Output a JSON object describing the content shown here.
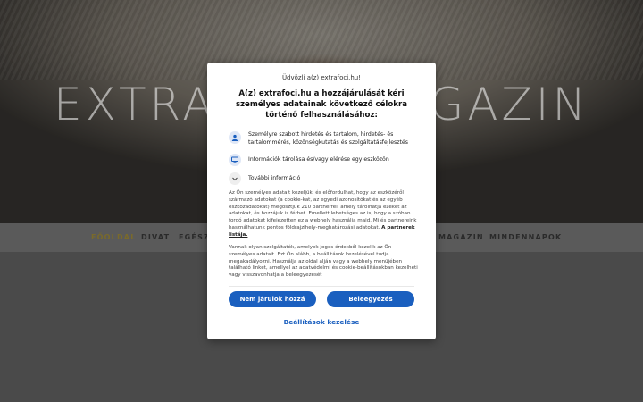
{
  "background": {
    "site_title": "EXTRAFOCI MAGAZIN",
    "nav": [
      "FŐOLDAL",
      "DIVAT",
      "EGÉSZSÉG",
      "MAGAZIN",
      "MINDENNAPOK"
    ]
  },
  "consent": {
    "welcome": "Üdvözli a(z) extrafoci.hu!",
    "heading": "A(z) extrafoci.hu a hozzájárulását kéri személyes adatainak következő célokra történő felhasználásához:",
    "purposes": [
      {
        "icon": "user-icon",
        "text": "Személyre szabott hirdetés és tartalom, hirdetés- és tartalommérés, közönségkutatás és szolgáltatásfejlesztés"
      },
      {
        "icon": "device-icon",
        "text": "Információk tárolása és/vagy elérése egy eszközön"
      }
    ],
    "more_info": "További információ",
    "paragraph1": "Az Ön személyes adatait kezeljük, és előfordulhat, hogy az eszközéről származó adatokat (a cookie-kat, az egyedi azonosítókat és az egyéb eszközadatokat) megosztjuk 210 partnerrel, amely tárolhatja ezeket az adatokat, és hozzájuk is férhet. Emellett lehetséges az is, hogy a szóban forgó adatokat kifejezetten ez a webhely használja majd. Mi és partnereink használhatunk pontos földrajzihely-meghatározási adatokat.",
    "partners_link": "A partnerek listája.",
    "paragraph2": "Vannak olyan szolgáltatók, amelyek jogos érdekből kezelik az Ön személyes adatait. Ezt Ön alább, a beállítások kezelésével tudja megakadályozni. Használja az oldal alján vagy a webhely menüjében található linket, amellyel az adatvédelmi és cookie-beállításokban kezelheti vagy visszavonhatja a beleegyezését",
    "decline_button": "Nem járulok hozzá",
    "accept_button": "Beleegyezés",
    "manage_link": "Beállítások kezelése",
    "accent_color": "#1a5fbf"
  }
}
